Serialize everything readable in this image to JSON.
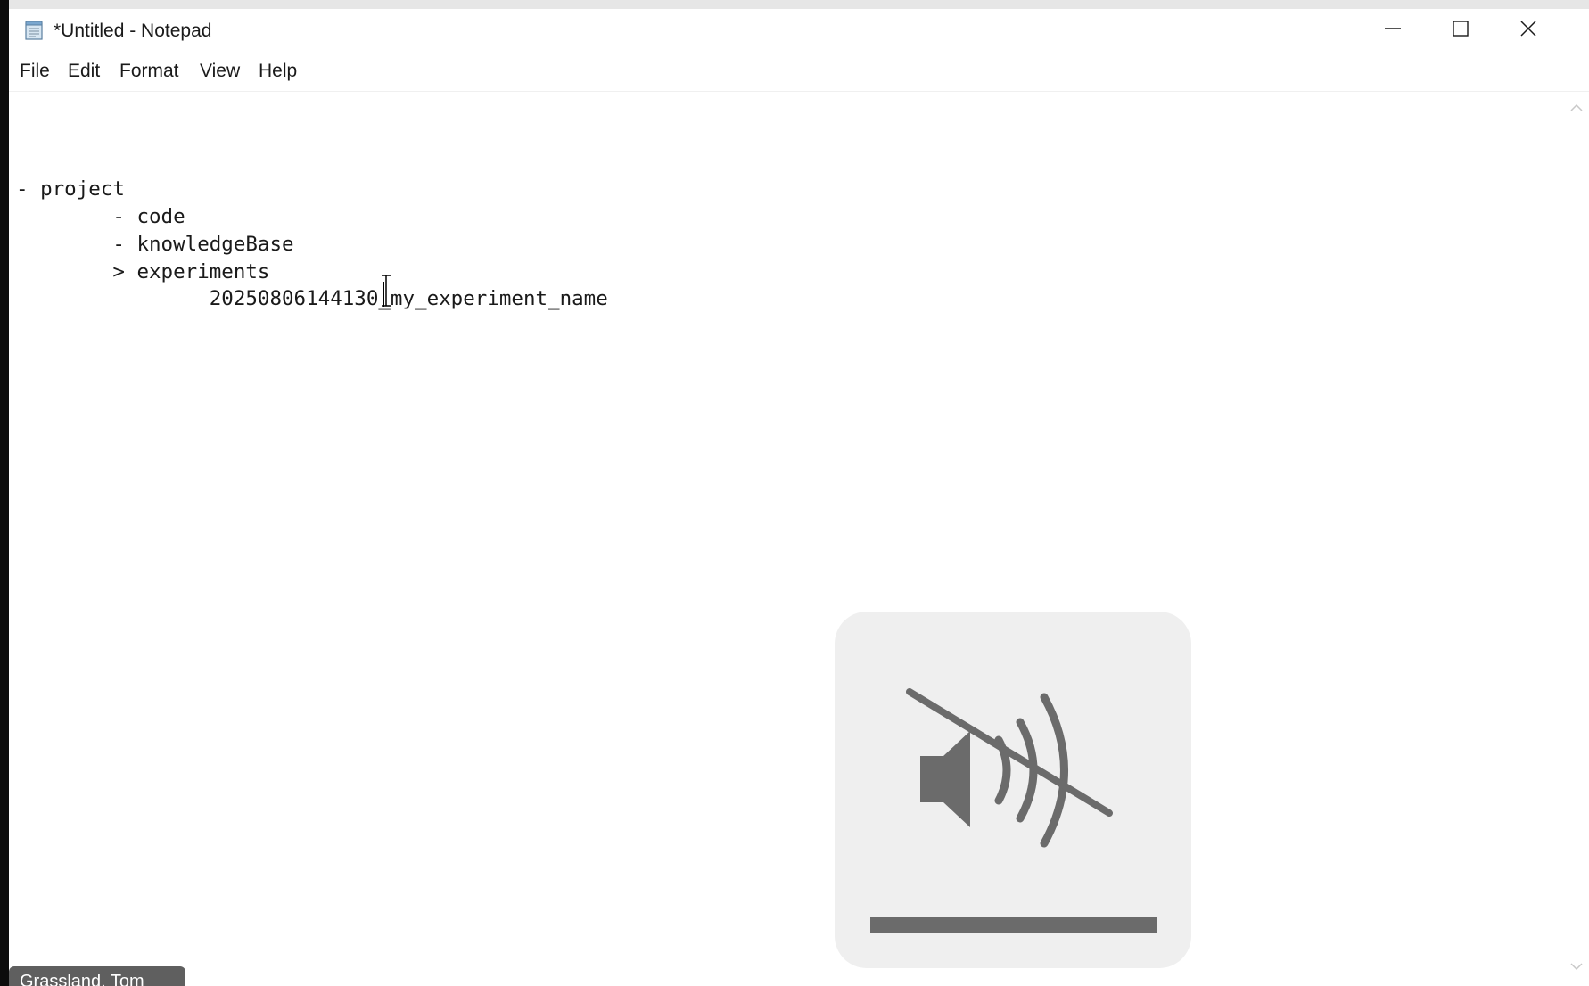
{
  "window": {
    "title": "*Untitled - Notepad",
    "app_icon": "notepad-icon",
    "controls": {
      "minimize_icon": "minimize-icon",
      "maximize_icon": "maximize-icon",
      "close_icon": "close-icon"
    }
  },
  "menubar": {
    "items": [
      {
        "label": "File"
      },
      {
        "label": "Edit"
      },
      {
        "label": "Format"
      },
      {
        "label": "View"
      },
      {
        "label": "Help"
      }
    ]
  },
  "editor": {
    "lines": [
      "- project",
      "        - code",
      "        - knowledgeBase",
      "        > experiments",
      "                20250806144130_my_experiment_name"
    ]
  },
  "volume_osd": {
    "icon": "volume-muted-icon",
    "level": 0,
    "colors": {
      "background": "#efefef",
      "icon": "#6b6b6b"
    }
  },
  "speaker_tag": {
    "label": "Grassland, Tom"
  }
}
